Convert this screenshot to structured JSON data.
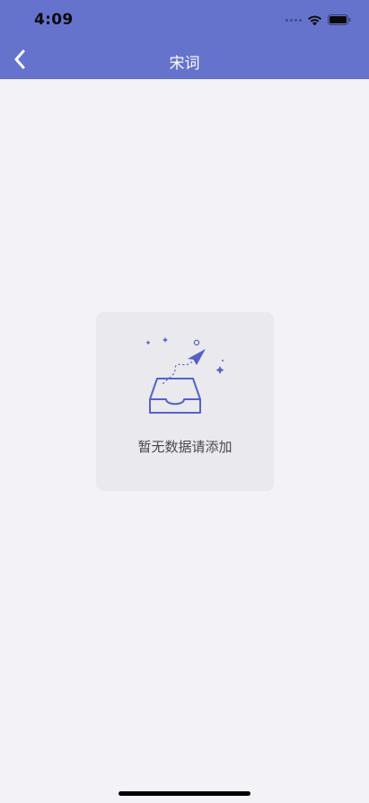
{
  "status_bar": {
    "time": "4:09",
    "icons": [
      "signal-icon",
      "wifi-icon",
      "battery-icon"
    ]
  },
  "nav": {
    "title": "宋词",
    "back_icon": "chevron-left-icon"
  },
  "empty_state": {
    "message": "暂无数据请添加",
    "illustration": "inbox-paper-plane-icon"
  },
  "colors": {
    "header": "#6573cc",
    "background": "#f2f2f7",
    "card": "#e9e9ee",
    "accent": "#5562c9"
  }
}
